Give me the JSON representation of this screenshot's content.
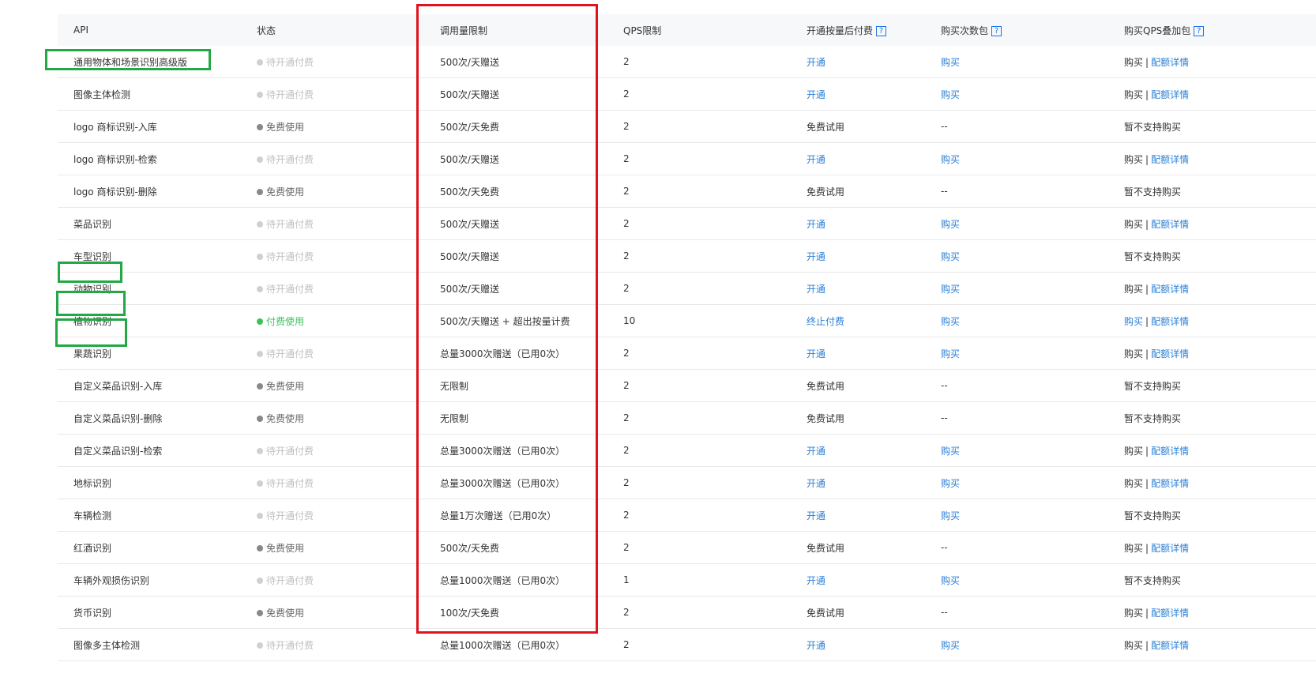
{
  "headers": {
    "api": "API",
    "status": "状态",
    "quota": "调用量限制",
    "qps": "QPS限制",
    "postpaid": "开通按量后付费",
    "packs": "购买次数包",
    "qps_pack": "购买QPS叠加包",
    "help": "?"
  },
  "rows": [
    {
      "api": "通用物体和场景识别高级版",
      "status": "待开通付费",
      "status_type": "pending",
      "quota": "500次/天赠送",
      "qps": "2",
      "postpaid": "开通",
      "postpaid_link": true,
      "pack": "购买",
      "pack_link": true,
      "qps_pack": "购买",
      "qps_detail": "配额详情"
    },
    {
      "api": "图像主体检测",
      "status": "待开通付费",
      "status_type": "pending",
      "quota": "500次/天赠送",
      "qps": "2",
      "postpaid": "开通",
      "postpaid_link": true,
      "pack": "购买",
      "pack_link": true,
      "qps_pack": "购买",
      "qps_detail": "配额详情"
    },
    {
      "api": "logo 商标识别-入库",
      "status": "免费使用",
      "status_type": "free",
      "quota": "500次/天免费",
      "qps": "2",
      "postpaid": "免费试用",
      "postpaid_link": false,
      "pack": "--",
      "pack_link": false,
      "qps_pack": "暂不支持购买",
      "qps_detail": ""
    },
    {
      "api": "logo 商标识别-检索",
      "status": "待开通付费",
      "status_type": "pending",
      "quota": "500次/天赠送",
      "qps": "2",
      "postpaid": "开通",
      "postpaid_link": true,
      "pack": "购买",
      "pack_link": true,
      "qps_pack": "购买",
      "qps_detail": "配额详情"
    },
    {
      "api": "logo 商标识别-删除",
      "status": "免费使用",
      "status_type": "free",
      "quota": "500次/天免费",
      "qps": "2",
      "postpaid": "免费试用",
      "postpaid_link": false,
      "pack": "--",
      "pack_link": false,
      "qps_pack": "暂不支持购买",
      "qps_detail": ""
    },
    {
      "api": "菜品识别",
      "status": "待开通付费",
      "status_type": "pending",
      "quota": "500次/天赠送",
      "qps": "2",
      "postpaid": "开通",
      "postpaid_link": true,
      "pack": "购买",
      "pack_link": true,
      "qps_pack": "购买",
      "qps_detail": "配额详情"
    },
    {
      "api": "车型识别",
      "status": "待开通付费",
      "status_type": "pending",
      "quota": "500次/天赠送",
      "qps": "2",
      "postpaid": "开通",
      "postpaid_link": true,
      "pack": "购买",
      "pack_link": true,
      "qps_pack": "暂不支持购买",
      "qps_detail": ""
    },
    {
      "api": "动物识别",
      "status": "待开通付费",
      "status_type": "pending",
      "quota": "500次/天赠送",
      "qps": "2",
      "postpaid": "开通",
      "postpaid_link": true,
      "pack": "购买",
      "pack_link": true,
      "qps_pack": "购买",
      "qps_detail": "配额详情"
    },
    {
      "api": "植物识别",
      "status": "付费使用",
      "status_type": "paid",
      "quota": "500次/天赠送 + 超出按量计费",
      "qps": "10",
      "postpaid": "终止付费",
      "postpaid_link": true,
      "pack": "购买",
      "pack_link": true,
      "qps_pack": "购买",
      "qps_pack_link": true,
      "qps_detail": "配额详情"
    },
    {
      "api": "果蔬识别",
      "status": "待开通付费",
      "status_type": "pending",
      "quota": "总量3000次赠送（已用0次）",
      "qps": "2",
      "postpaid": "开通",
      "postpaid_link": true,
      "pack": "购买",
      "pack_link": true,
      "qps_pack": "购买",
      "qps_detail": "配额详情"
    },
    {
      "api": "自定义菜品识别-入库",
      "status": "免费使用",
      "status_type": "free",
      "quota": "无限制",
      "qps": "2",
      "postpaid": "免费试用",
      "postpaid_link": false,
      "pack": "--",
      "pack_link": false,
      "qps_pack": "暂不支持购买",
      "qps_detail": ""
    },
    {
      "api": "自定义菜品识别-删除",
      "status": "免费使用",
      "status_type": "free",
      "quota": "无限制",
      "qps": "2",
      "postpaid": "免费试用",
      "postpaid_link": false,
      "pack": "--",
      "pack_link": false,
      "qps_pack": "暂不支持购买",
      "qps_detail": ""
    },
    {
      "api": "自定义菜品识别-检索",
      "status": "待开通付费",
      "status_type": "pending",
      "quota": "总量3000次赠送（已用0次）",
      "qps": "2",
      "postpaid": "开通",
      "postpaid_link": true,
      "pack": "购买",
      "pack_link": true,
      "qps_pack": "购买",
      "qps_detail": "配额详情"
    },
    {
      "api": "地标识别",
      "status": "待开通付费",
      "status_type": "pending",
      "quota": "总量3000次赠送（已用0次）",
      "qps": "2",
      "postpaid": "开通",
      "postpaid_link": true,
      "pack": "购买",
      "pack_link": true,
      "qps_pack": "购买",
      "qps_detail": "配额详情"
    },
    {
      "api": "车辆检测",
      "status": "待开通付费",
      "status_type": "pending",
      "quota": "总量1万次赠送（已用0次）",
      "qps": "2",
      "postpaid": "开通",
      "postpaid_link": true,
      "pack": "购买",
      "pack_link": true,
      "qps_pack": "暂不支持购买",
      "qps_detail": ""
    },
    {
      "api": "红酒识别",
      "status": "免费使用",
      "status_type": "free",
      "quota": "500次/天免费",
      "qps": "2",
      "postpaid": "免费试用",
      "postpaid_link": false,
      "pack": "--",
      "pack_link": false,
      "qps_pack": "购买",
      "qps_detail": "配额详情"
    },
    {
      "api": "车辆外观损伤识别",
      "status": "待开通付费",
      "status_type": "pending",
      "quota": "总量1000次赠送（已用0次）",
      "qps": "1",
      "postpaid": "开通",
      "postpaid_link": true,
      "pack": "购买",
      "pack_link": true,
      "qps_pack": "暂不支持购买",
      "qps_detail": ""
    },
    {
      "api": "货币识别",
      "status": "免费使用",
      "status_type": "free",
      "quota": "100次/天免费",
      "qps": "2",
      "postpaid": "免费试用",
      "postpaid_link": false,
      "pack": "--",
      "pack_link": false,
      "qps_pack": "购买",
      "qps_detail": "配额详情"
    },
    {
      "api": "图像多主体检测",
      "status": "待开通付费",
      "status_type": "pending",
      "quota": "总量1000次赠送（已用0次）",
      "qps": "2",
      "postpaid": "开通",
      "postpaid_link": true,
      "pack": "购买",
      "pack_link": true,
      "qps_pack": "购买",
      "qps_detail": "配额详情"
    }
  ],
  "colors": {
    "link": "#2a7fd6",
    "red_highlight": "#e0131c",
    "green_highlight": "#22a845",
    "paid": "#3ac25a"
  }
}
